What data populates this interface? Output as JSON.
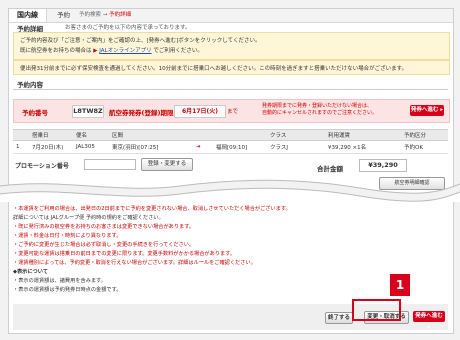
{
  "tabs": {
    "domestic": "国内線",
    "reserve": "予約"
  },
  "breadcrumb": {
    "search": "予約検索",
    "arrow": "→",
    "current": "予約詳細"
  },
  "page": {
    "title": "予約詳細",
    "desc": "お客さまのご予約を以下の内容で承っております。"
  },
  "info": {
    "line1": "ご予約内容及び「ご注意・ご案内」をご確認の上、[発券へ進む]ボタンをクリックしてください。",
    "line2_prefix": "既に航空券をお持ちの場合は",
    "line2_link": "JALオンラインアプリ",
    "line2_suffix": "でご利用ください。"
  },
  "warning": "便出発31分前までに必ず保安検査を通過してください。10分前までに搭乗口へお越しください。この時刻を過ぎますと搭乗いただけない場合がございます。",
  "section": {
    "title": "予約内容"
  },
  "booking": {
    "label": "予約番号",
    "number": "L8TW8Z",
    "deadline_label": "航空券発券(登録)期限",
    "deadline": "6月17日(火)",
    "deadline_suffix": "まで",
    "note1": "発券期限までに発券・登録いただけない場合は、",
    "note2": "自動的にキャンセルされますのでご注意ください。",
    "issue_button": "発券へ進む"
  },
  "table": {
    "headers": [
      "搭乗日",
      "便名",
      "区間",
      "",
      "",
      "クラス",
      "利用運賃",
      "予約区分"
    ],
    "rows": [
      {
        "no": "1",
        "date": "7月20日(木)",
        "flight": "JAL305",
        "from": "東京(羽田)[07:25]",
        "arrow": "➜",
        "to": "福岡[09:10]",
        "class": "クラスJ",
        "fare": "¥39,290 ×1名",
        "status": "予約OK"
      }
    ]
  },
  "promo": {
    "label": "プロモーション番号",
    "button": "登録・変更する"
  },
  "total": {
    "label": "合計金額",
    "value": "¥39,290"
  },
  "receipt_button": "航空券明細確認",
  "notes": [
    "・本運賃をご利用の場合は、出発日の2日前までに予約を変更されない場合、取消しさせていただく場合がございます。",
    "詳細については JALグループ便 予約時の規約をご確認ください。",
    "・既に発行済みの航空券をお持ちのお客さまは変更できない場合があります。",
    "・運賃・料金は日付・時刻により異なります。",
    "・ご予約に変更が生じた場合は必ず取消し・変更の手続きを行ってください。",
    "・変更可能な運賃は搭乗日の前日までの変更に限ります。変更手数料がかかる場合があります。",
    "・運賃種別によっては、予約変更・取消を行えない場合がございます。詳細はルールをご確認ください。",
    "◆表示について",
    "・表示の運賃額は、諸費用を含みます。",
    "・表示の運賃額は予約発券日時点の金額です。"
  ],
  "footer": {
    "end": "終了する",
    "change": "変更・取消する",
    "issue": "発券へ進む"
  },
  "callout": {
    "number": "1"
  }
}
